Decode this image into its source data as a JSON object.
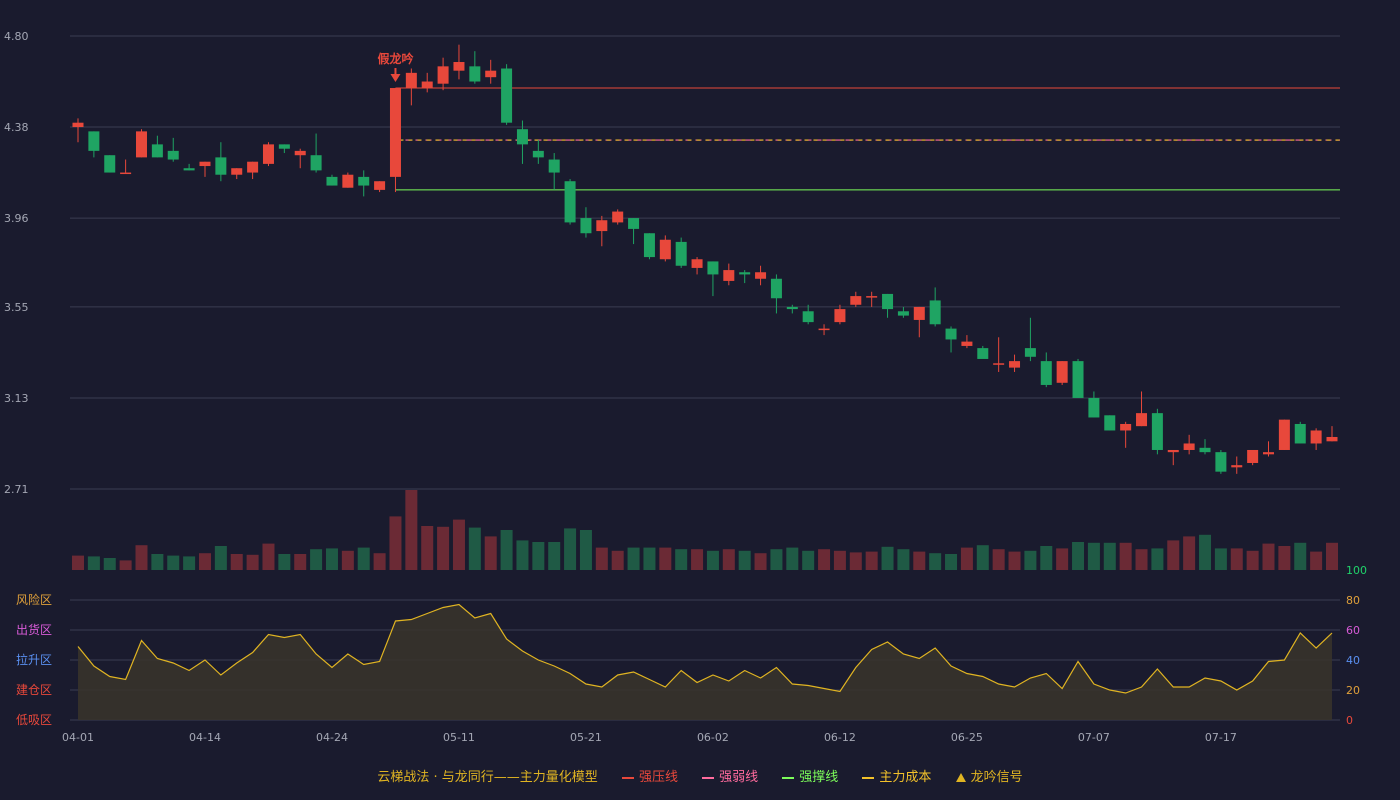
{
  "colors": {
    "background": "#1a1b2e",
    "grid": "#3a3d52",
    "axis_text": "#a4a7b4",
    "up": "#e8483b",
    "down": "#1fa463",
    "vol_up": "#6b2a35",
    "vol_down": "#1f5a45",
    "resistance": "#e8483b",
    "weak": "#ff6b9d",
    "support": "#7cfc5a",
    "cost": "#f3c12a",
    "osc_line": "#e0b422",
    "osc_fill": "#3a342a",
    "signal": "#e8483b"
  },
  "chart_data": {
    "type": "candlestick",
    "price_axis": {
      "ticks": [
        "4.80",
        "4.38",
        "3.96",
        "3.55",
        "3.13",
        "2.71"
      ],
      "range": [
        2.71,
        4.8
      ]
    },
    "x_axis": {
      "labels": [
        "04-01",
        "04-14",
        "04-24",
        "05-11",
        "05-21",
        "06-02",
        "06-12",
        "06-25",
        "07-07",
        "07-17"
      ],
      "label_index": [
        0,
        8,
        16,
        24,
        32,
        40,
        48,
        56,
        64,
        72
      ]
    },
    "candles": [
      [
        4.38,
        4.4,
        4.42,
        4.31
      ],
      [
        4.36,
        4.27,
        4.36,
        4.24
      ],
      [
        4.25,
        4.17,
        4.25,
        4.17
      ],
      [
        4.17,
        4.17,
        4.23,
        4.17
      ],
      [
        4.24,
        4.36,
        4.37,
        4.24
      ],
      [
        4.3,
        4.24,
        4.34,
        4.24
      ],
      [
        4.27,
        4.23,
        4.33,
        4.22
      ],
      [
        4.19,
        4.18,
        4.21,
        4.18
      ],
      [
        4.2,
        4.22,
        4.22,
        4.15
      ],
      [
        4.24,
        4.16,
        4.31,
        4.13
      ],
      [
        4.16,
        4.19,
        4.19,
        4.14
      ],
      [
        4.17,
        4.22,
        4.22,
        4.14
      ],
      [
        4.21,
        4.3,
        4.31,
        4.2
      ],
      [
        4.3,
        4.28,
        4.3,
        4.26
      ],
      [
        4.25,
        4.27,
        4.28,
        4.19
      ],
      [
        4.25,
        4.18,
        4.35,
        4.17
      ],
      [
        4.15,
        4.11,
        4.16,
        4.11
      ],
      [
        4.1,
        4.16,
        4.17,
        4.1
      ],
      [
        4.15,
        4.11,
        4.18,
        4.06
      ],
      [
        4.09,
        4.13,
        4.13,
        4.08
      ],
      [
        4.15,
        4.56,
        4.56,
        4.08
      ],
      [
        4.56,
        4.63,
        4.65,
        4.48
      ],
      [
        4.56,
        4.59,
        4.63,
        4.54
      ],
      [
        4.58,
        4.66,
        4.7,
        4.55
      ],
      [
        4.64,
        4.68,
        4.76,
        4.6
      ],
      [
        4.66,
        4.59,
        4.73,
        4.58
      ],
      [
        4.61,
        4.64,
        4.69,
        4.58
      ],
      [
        4.65,
        4.4,
        4.67,
        4.39
      ],
      [
        4.37,
        4.3,
        4.41,
        4.21
      ],
      [
        4.27,
        4.24,
        4.32,
        4.21
      ],
      [
        4.23,
        4.17,
        4.26,
        4.09
      ],
      [
        4.13,
        3.94,
        4.14,
        3.93
      ],
      [
        3.96,
        3.89,
        4.01,
        3.87
      ],
      [
        3.9,
        3.95,
        3.97,
        3.83
      ],
      [
        3.94,
        3.99,
        4.0,
        3.93
      ],
      [
        3.96,
        3.91,
        3.96,
        3.84
      ],
      [
        3.89,
        3.78,
        3.89,
        3.77
      ],
      [
        3.77,
        3.86,
        3.88,
        3.76
      ],
      [
        3.85,
        3.74,
        3.87,
        3.73
      ],
      [
        3.73,
        3.77,
        3.78,
        3.7
      ],
      [
        3.76,
        3.7,
        3.76,
        3.6
      ],
      [
        3.67,
        3.72,
        3.75,
        3.65
      ],
      [
        3.71,
        3.7,
        3.72,
        3.66
      ],
      [
        3.68,
        3.71,
        3.74,
        3.65
      ],
      [
        3.68,
        3.59,
        3.7,
        3.52
      ],
      [
        3.55,
        3.54,
        3.56,
        3.52
      ],
      [
        3.53,
        3.48,
        3.56,
        3.47
      ],
      [
        3.45,
        3.45,
        3.47,
        3.42
      ],
      [
        3.48,
        3.54,
        3.56,
        3.47
      ],
      [
        3.56,
        3.6,
        3.62,
        3.55
      ],
      [
        3.6,
        3.6,
        3.62,
        3.55
      ],
      [
        3.61,
        3.54,
        3.61,
        3.5
      ],
      [
        3.53,
        3.51,
        3.55,
        3.5
      ],
      [
        3.49,
        3.55,
        3.55,
        3.41
      ],
      [
        3.58,
        3.47,
        3.64,
        3.46
      ],
      [
        3.45,
        3.4,
        3.46,
        3.34
      ],
      [
        3.37,
        3.39,
        3.42,
        3.36
      ],
      [
        3.36,
        3.31,
        3.37,
        3.32
      ],
      [
        3.29,
        3.29,
        3.41,
        3.25
      ],
      [
        3.27,
        3.3,
        3.33,
        3.25
      ],
      [
        3.36,
        3.32,
        3.5,
        3.3
      ],
      [
        3.3,
        3.19,
        3.34,
        3.18
      ],
      [
        3.2,
        3.3,
        3.3,
        3.19
      ],
      [
        3.3,
        3.13,
        3.31,
        3.13
      ],
      [
        3.13,
        3.04,
        3.16,
        3.04
      ],
      [
        3.05,
        2.98,
        3.05,
        2.98
      ],
      [
        2.98,
        3.01,
        3.02,
        2.9
      ],
      [
        3.0,
        3.06,
        3.16,
        3.0
      ],
      [
        3.06,
        2.89,
        3.08,
        2.87
      ],
      [
        2.88,
        2.89,
        2.89,
        2.82
      ],
      [
        2.89,
        2.92,
        2.96,
        2.87
      ],
      [
        2.9,
        2.88,
        2.94,
        2.87
      ],
      [
        2.88,
        2.79,
        2.89,
        2.78
      ],
      [
        2.81,
        2.82,
        2.86,
        2.78
      ],
      [
        2.83,
        2.89,
        2.89,
        2.82
      ],
      [
        2.87,
        2.88,
        2.93,
        2.86
      ],
      [
        2.89,
        3.03,
        3.03,
        2.89
      ],
      [
        3.01,
        2.92,
        3.02,
        2.92
      ],
      [
        2.92,
        2.98,
        2.99,
        2.89
      ],
      [
        2.93,
        2.95,
        3.0,
        2.93
      ]
    ],
    "volume": [
      18,
      17,
      15,
      12,
      31,
      20,
      18,
      17,
      21,
      30,
      20,
      19,
      33,
      20,
      20,
      26,
      27,
      24,
      28,
      21,
      67,
      100,
      55,
      54,
      63,
      53,
      42,
      50,
      37,
      35,
      35,
      52,
      50,
      28,
      24,
      28,
      28,
      28,
      26,
      26,
      24,
      26,
      24,
      21,
      26,
      28,
      24,
      26,
      24,
      22,
      23,
      29,
      26,
      23,
      21,
      20,
      28,
      31,
      26,
      23,
      24,
      30,
      27,
      35,
      34,
      34,
      34,
      26,
      27,
      37,
      42,
      44,
      27,
      27,
      24,
      33,
      30,
      34,
      23,
      34
    ],
    "price_lines": {
      "resistance": 4.56,
      "weak": 4.32,
      "cost": 4.32,
      "support": 4.09
    },
    "signal": {
      "index": 20,
      "label": "假龙吟"
    },
    "oscillator": {
      "ticks": [
        0,
        20,
        40,
        60,
        80,
        100
      ],
      "range": [
        0,
        100
      ],
      "zones": [
        "风险区",
        "出货区",
        "拉升区",
        "建仓区",
        "低吸区"
      ],
      "zone_colors": [
        "#e0a03a",
        "#d95bd8",
        "#5a8ff0",
        "#e8483b",
        "#e8483b"
      ],
      "tick_colors": [
        "#e8483b",
        "#e0a03a",
        "#5a8ff0",
        "#d95bd8",
        "#e0a03a",
        "#1fd36a"
      ],
      "values": [
        49,
        36,
        29,
        27,
        53,
        41,
        38,
        33,
        40,
        30,
        38,
        45,
        57,
        55,
        57,
        44,
        35,
        44,
        37,
        39,
        66,
        67,
        71,
        75,
        77,
        68,
        71,
        54,
        46,
        40,
        36,
        31,
        24,
        22,
        30,
        32,
        27,
        22,
        33,
        25,
        30,
        26,
        33,
        28,
        35,
        24,
        23,
        21,
        19,
        35,
        47,
        52,
        44,
        41,
        48,
        36,
        31,
        29,
        24,
        22,
        28,
        31,
        21,
        39,
        24,
        20,
        18,
        22,
        34,
        22,
        22,
        28,
        26,
        20,
        26,
        39,
        40,
        58,
        48,
        58
      ]
    },
    "legend": [
      {
        "text": "云梯战法 · 与龙同行——主力量化模型",
        "color": "#e0b422",
        "symbol": "none"
      },
      {
        "text": "强压线",
        "color": "#e8483b",
        "symbol": "line"
      },
      {
        "text": "强弱线",
        "color": "#ff6b9d",
        "symbol": "dash"
      },
      {
        "text": "强撑线",
        "color": "#7cfc5a",
        "symbol": "line"
      },
      {
        "text": "主力成本",
        "color": "#f3c12a",
        "symbol": "dash"
      },
      {
        "text": "龙吟信号",
        "color": "#e0b422",
        "symbol": "tri"
      }
    ]
  }
}
